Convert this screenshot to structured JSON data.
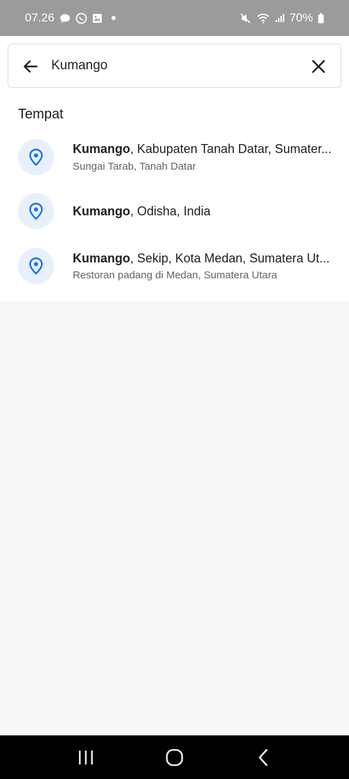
{
  "status_bar": {
    "time": "07.26",
    "battery": "70%",
    "left_icons": [
      "chat-bubble-icon",
      "whatsapp-icon",
      "gallery-icon",
      "dot-icon"
    ],
    "right_icons": [
      "mute-icon",
      "wifi-icon",
      "signal-icon",
      "battery-icon"
    ]
  },
  "search": {
    "value": "Kumango",
    "back_icon": "arrow-left-icon",
    "clear_icon": "close-icon"
  },
  "section": {
    "title": "Tempat"
  },
  "results": [
    {
      "name": "Kumango",
      "detail": ", Kabupaten Tanah Datar, Sumater...",
      "subtitle": "Sungai Tarab, Tanah Datar",
      "icon": "location-pin-icon"
    },
    {
      "name": "Kumango",
      "detail": ", Odisha, India",
      "subtitle": "",
      "icon": "location-pin-icon"
    },
    {
      "name": "Kumango",
      "detail": ", Sekip, Kota Medan, Sumatera Ut...",
      "subtitle": "Restoran padang di Medan, Sumatera Utara",
      "icon": "location-pin-icon"
    }
  ],
  "nav_bar": {
    "icons": [
      "recent-apps-icon",
      "home-icon",
      "back-icon"
    ]
  },
  "colors": {
    "accent": "#1a73e8",
    "pin_bg": "#e8f0fe",
    "status_bar": "#9b9b9b",
    "background": "#f6f7f9"
  }
}
